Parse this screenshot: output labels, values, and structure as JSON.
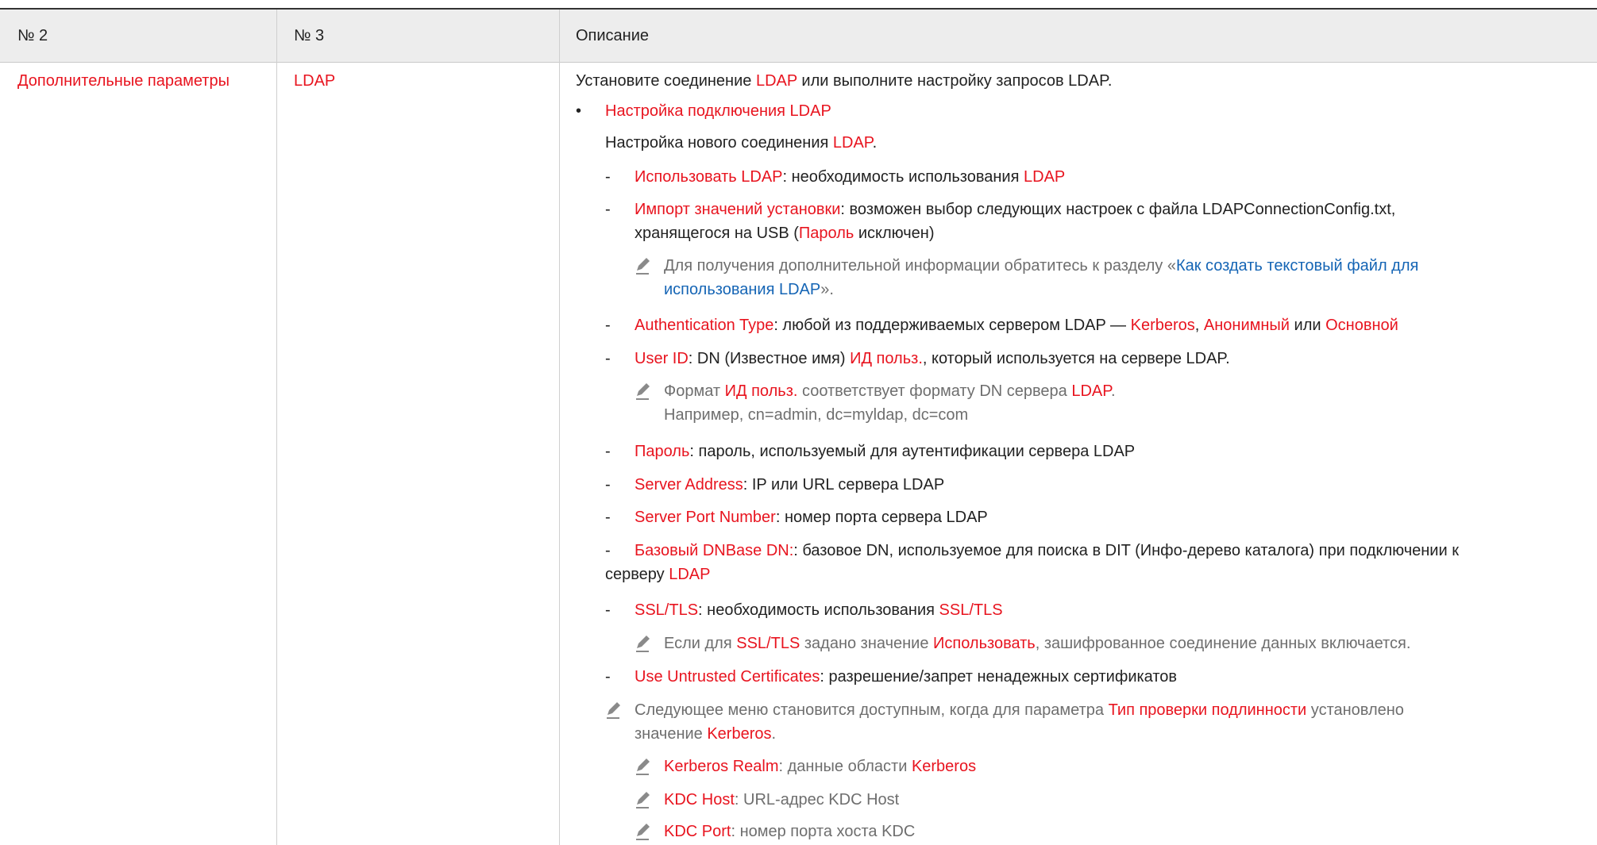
{
  "header": {
    "col2": "№ 2",
    "col3": "№ 3",
    "desc": "Описание"
  },
  "row": {
    "col2": "Дополнительные параметры",
    "col3": "LDAP",
    "intro": [
      "Установите соединение ",
      "LDAP",
      " или выполните настройку запросов LDAP."
    ],
    "bullet_title": "Настройка подключения LDAP",
    "bullet_text": [
      "Настройка нового соединения ",
      "LDAP",
      "."
    ],
    "items": {
      "use_ldap": [
        "Использовать LDAP",
        ": необходимость использования ",
        "LDAP"
      ],
      "import_1": [
        "Импорт значений установки",
        ": возможен выбор следующих настроек с файла LDAPConnectionConfig.txt,"
      ],
      "import_2": [
        "хранящегося на USB (",
        "Пароль",
        " исключен)"
      ],
      "note1_1": [
        "Для получения дополнительной информации обратитесь к разделу «",
        "Как создать текстовый файл для"
      ],
      "note1_2": [
        "использования LDAP",
        "»."
      ],
      "auth": [
        "Authentication Type",
        ": любой из поддерживаемых сервером LDAP — ",
        "Kerberos",
        ", ",
        "Анонимный",
        " или ",
        "Основной"
      ],
      "user": [
        "User ID",
        ": DN (Известное имя) ",
        "ИД польз.",
        ", который используется на сервере LDAP."
      ],
      "note2_1": [
        "Формат ",
        "ИД польз.",
        " соответствует формату DN сервера ",
        "LDAP",
        "."
      ],
      "note2_2": "Например, cn=admin, dc=myldap, dc=com",
      "password": [
        "Пароль",
        ": пароль, используемый для аутентификации сервера LDAP"
      ],
      "server": [
        "Server Address",
        ": IP или URL сервера LDAP"
      ],
      "port": [
        "Server Port Number",
        ": номер порта сервера LDAP"
      ],
      "base_1": [
        "Базовый DNBase DN:",
        ": базовое DN, используемое для поиска в DIT (Инфо-дерево каталога) при подключении к"
      ],
      "base_2": [
        "серверу ",
        "LDAP"
      ],
      "ssl": [
        "SSL/TLS",
        ": необходимость использования ",
        "SSL/TLS"
      ],
      "note3": [
        "Если для ",
        "SSL/TLS",
        " задано значение ",
        "Использовать",
        ", зашифрованное соединение данных включается."
      ],
      "untrusted": [
        "Use Untrusted Certificates",
        ": разрешение/запрет ненадежных сертификатов"
      ],
      "note4_1": [
        "Следующее меню становится доступным, когда для параметра ",
        "Тип проверки подлинности",
        " установлено"
      ],
      "note4_2": [
        "значение ",
        "Kerberos",
        "."
      ],
      "realm": [
        "Kerberos Realm",
        ": данные области ",
        "Kerberos"
      ],
      "kdc_host": [
        "KDC Host",
        ": URL-адрес KDC Host"
      ],
      "kdc_port": [
        "KDC Port",
        ": номер порта хоста KDC"
      ]
    }
  },
  "colors": {
    "accent": "#e8141f",
    "link": "#1565b5",
    "note": "#6e6e6e",
    "header_bg": "#ededed"
  },
  "icons": {
    "note": "pencil-icon",
    "bullet": "bullet-dot"
  }
}
